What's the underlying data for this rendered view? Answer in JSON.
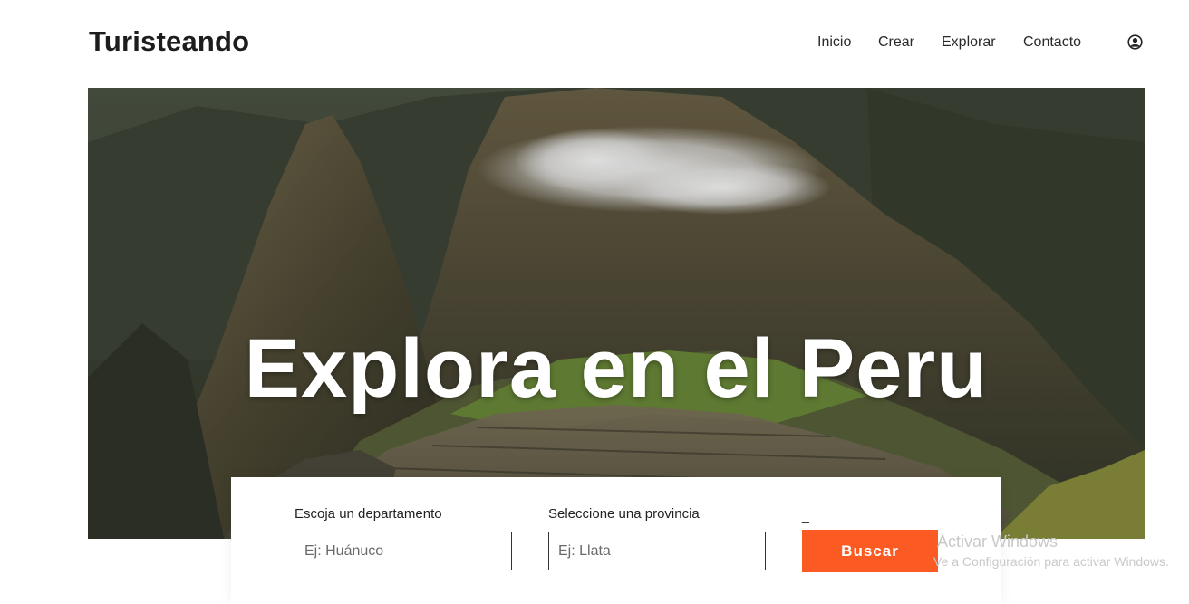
{
  "header": {
    "brand": "Turisteando",
    "nav": [
      {
        "label": "Inicio"
      },
      {
        "label": "Crear"
      },
      {
        "label": "Explorar"
      },
      {
        "label": "Contacto"
      }
    ],
    "user_icon": "user-circle-icon"
  },
  "hero": {
    "title": "Explora en el Peru",
    "image": "machu-picchu-mountains-photo"
  },
  "search": {
    "department_label": "Escoja un departamento",
    "department_placeholder": "Ej: Huánuco",
    "province_label": "Seleccione una provincia",
    "province_placeholder": "Ej: Llata",
    "third_label": "_",
    "button_label": "Buscar",
    "button_color": "#fb5a22"
  },
  "watermark": {
    "title": "Activar Windows",
    "subtitle": "Ve a Configuración para activar Windows."
  }
}
